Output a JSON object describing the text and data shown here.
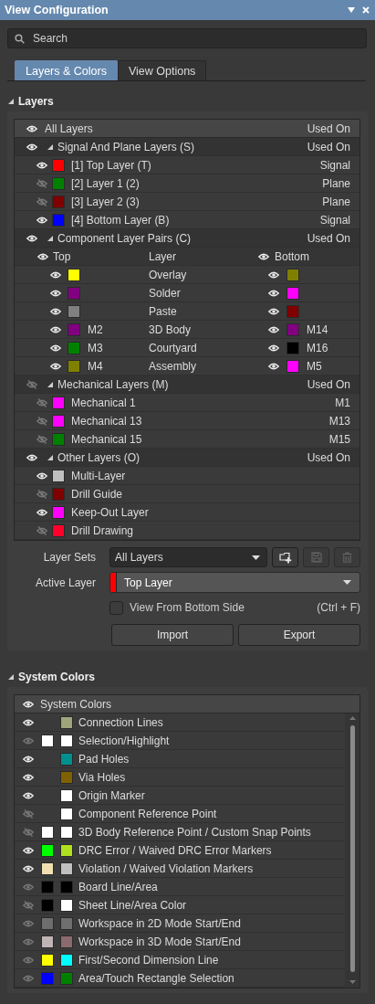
{
  "window": {
    "title": "View Configuration"
  },
  "search": {
    "placeholder": "Search"
  },
  "tabs": [
    {
      "label": "Layers & Colors",
      "selected": true
    },
    {
      "label": "View Options",
      "selected": false
    }
  ],
  "layers_section": {
    "title": "Layers",
    "expanded": true,
    "header": {
      "label": "All Layers",
      "used_on": "Used On",
      "visible": true
    },
    "groups": [
      {
        "kind": "list",
        "label": "Signal And Plane Layers (S)",
        "used_on": "Used On",
        "visible": true,
        "expanded": true,
        "layers": [
          {
            "name": "[1] Top Layer (T)",
            "color": "#ff0000",
            "visible": true,
            "usage": "Signal"
          },
          {
            "name": "[2] Layer 1 (2)",
            "color": "#008000",
            "visible": false,
            "usage": "Plane"
          },
          {
            "name": "[3] Layer 2 (3)",
            "color": "#800000",
            "visible": false,
            "usage": "Plane"
          },
          {
            "name": "[4] Bottom Layer (B)",
            "color": "#0000ff",
            "visible": true,
            "usage": "Signal"
          }
        ]
      },
      {
        "kind": "pairs",
        "label": "Component Layer Pairs (C)",
        "used_on": "Used On",
        "visible": true,
        "expanded": true,
        "columns": {
          "top": "Top",
          "top_visible": true,
          "layer": "Layer",
          "bottom": "Bottom",
          "bottom_visible": true
        },
        "pairs": [
          {
            "top": {
              "visible": true,
              "color": "#ffff00"
            },
            "layer": "Overlay",
            "bottom": {
              "visible": true,
              "color": "#808000"
            }
          },
          {
            "top": {
              "visible": true,
              "color": "#800080"
            },
            "layer": "Solder",
            "bottom": {
              "visible": true,
              "color": "#ff00ff"
            }
          },
          {
            "top": {
              "visible": true,
              "color": "#808080"
            },
            "layer": "Paste",
            "bottom": {
              "visible": true,
              "color": "#800000"
            }
          },
          {
            "top": {
              "visible": true,
              "color": "#800080",
              "label": "M2"
            },
            "layer": "3D Body",
            "bottom": {
              "visible": true,
              "color": "#800080",
              "label": "M14"
            }
          },
          {
            "top": {
              "visible": true,
              "color": "#008000",
              "label": "M3"
            },
            "layer": "Courtyard",
            "bottom": {
              "visible": true,
              "color": "#000000",
              "label": "M16"
            }
          },
          {
            "top": {
              "visible": true,
              "color": "#808000",
              "label": "M4"
            },
            "layer": "Assembly",
            "bottom": {
              "visible": true,
              "color": "#ff00ff",
              "label": "M5"
            }
          }
        ]
      },
      {
        "kind": "list",
        "label": "Mechanical Layers (M)",
        "used_on": "Used On",
        "visible": false,
        "expanded": true,
        "layers": [
          {
            "name": "Mechanical 1",
            "color": "#ff00ff",
            "visible": false,
            "usage": "M1"
          },
          {
            "name": "Mechanical 13",
            "color": "#ff00ff",
            "visible": false,
            "usage": "M13"
          },
          {
            "name": "Mechanical 15",
            "color": "#008000",
            "visible": false,
            "usage": "M15"
          }
        ]
      },
      {
        "kind": "list",
        "label": "Other Layers (O)",
        "used_on": "Used On",
        "visible": true,
        "expanded": true,
        "layers": [
          {
            "name": "Multi-Layer",
            "color": "#c0c0c0",
            "visible": true
          },
          {
            "name": "Drill Guide",
            "color": "#800000",
            "visible": false
          },
          {
            "name": "Keep-Out Layer",
            "color": "#ff00ff",
            "visible": true
          },
          {
            "name": "Drill Drawing",
            "color": "#ff002a",
            "visible": false
          }
        ]
      }
    ]
  },
  "layer_sets": {
    "label": "Layer Sets",
    "value": "All Layers",
    "buttons": [
      {
        "kind": "add",
        "disabled": false
      },
      {
        "kind": "save",
        "disabled": true
      },
      {
        "kind": "delete",
        "disabled": true
      }
    ]
  },
  "active_layer": {
    "label": "Active Layer",
    "value": "Top Layer",
    "color": "#ff0000"
  },
  "view_from_bottom": {
    "label": "View From Bottom Side",
    "checked": false,
    "shortcut": "(Ctrl + F)"
  },
  "buttons": [
    "Import",
    "Export"
  ],
  "system_colors_section": {
    "title": "System Colors",
    "expanded": true,
    "header": {
      "label": "System Colors",
      "visible": true
    },
    "items": [
      {
        "name": "Connection Lines",
        "visible": true,
        "dimmed": false,
        "second": {
          "color": "#a0a47a"
        }
      },
      {
        "name": "Selection/Highlight",
        "visible": true,
        "dimmed": true,
        "first": {
          "color": "#ffffff"
        },
        "second": {
          "color": "#ffffff"
        }
      },
      {
        "name": "Pad Holes",
        "visible": true,
        "dimmed": false,
        "second": {
          "color": "#00908f"
        }
      },
      {
        "name": "Via Holes",
        "visible": true,
        "dimmed": false,
        "second": {
          "color": "#806000"
        }
      },
      {
        "name": "Origin Marker",
        "visible": true,
        "dimmed": false,
        "second": {
          "color": "#ffffff"
        }
      },
      {
        "name": "Component Reference Point",
        "visible": false,
        "second": {
          "color": "#ffffff"
        }
      },
      {
        "name": "3D Body Reference Point / Custom Snap Points",
        "visible": false,
        "first": {
          "color": "#ffffff"
        },
        "second": {
          "color": "#ffffff"
        }
      },
      {
        "name": "DRC Error / Waived DRC Error Markers",
        "visible": true,
        "dimmed": false,
        "first": {
          "color": "#00ff00"
        },
        "second": {
          "color": "#b0e020"
        }
      },
      {
        "name": "Violation / Waived Violation Markers",
        "visible": true,
        "dimmed": false,
        "first": {
          "color": "#f0e0b0"
        },
        "second": {
          "color": "#c0c0c0"
        }
      },
      {
        "name": "Board Line/Area",
        "visible": true,
        "dimmed": true,
        "first": {
          "color": "#000000"
        },
        "second": {
          "color": "#000000"
        }
      },
      {
        "name": "Sheet Line/Area Color",
        "visible": false,
        "first": {
          "color": "#000000"
        },
        "second": {
          "color": "#ffffff"
        }
      },
      {
        "name": "Workspace in 2D Mode Start/End",
        "visible": true,
        "dimmed": true,
        "first": {
          "color": "#6e6e6e"
        },
        "second": {
          "color": "#6e6e6e"
        }
      },
      {
        "name": "Workspace in 3D Mode Start/End",
        "visible": true,
        "dimmed": true,
        "first": {
          "color": "#c0b4b4"
        },
        "second": {
          "color": "#8a6a6e"
        }
      },
      {
        "name": "First/Second Dimension Line",
        "visible": true,
        "dimmed": true,
        "first": {
          "color": "#ffff00"
        },
        "second": {
          "color": "#00ffff"
        }
      },
      {
        "name": "Area/Touch Rectangle Selection",
        "visible": true,
        "dimmed": true,
        "first": {
          "color": "#0000ff"
        },
        "second": {
          "color": "#008000"
        }
      }
    ]
  }
}
